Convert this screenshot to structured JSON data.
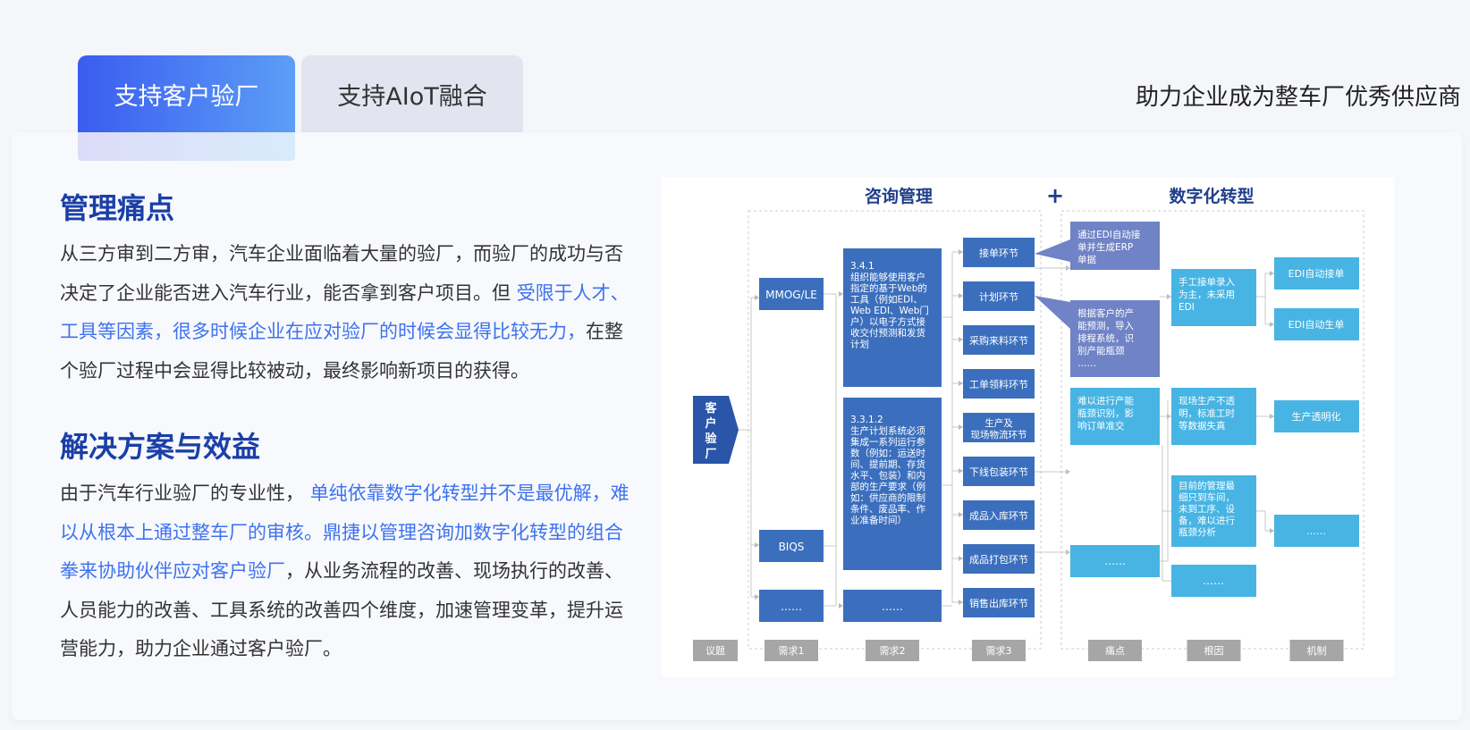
{
  "tabs": [
    {
      "label": "支持客户验厂",
      "active": true
    },
    {
      "label": "支持AIoT融合",
      "active": false
    }
  ],
  "tagline": "助力企业成为整车厂优秀供应商",
  "section1": {
    "title": "管理痛点",
    "text_a": "从三方审到二方审，汽车企业面临着大量的验厂，而验厂的成功与否决定了企业能否进入汽车行业，能否拿到客户项目。但 ",
    "highlight": "受限于人才、工具等因素，很多时候企业在应对验厂的时候会显得比较无力，",
    "text_b": "在整个验厂过程中会显得比较被动，最终影响新项目的获得。"
  },
  "section2": {
    "title": "解决方案与效益",
    "text_a": "由于汽车行业验厂的专业性， ",
    "highlight": "单纯依靠数字化转型并不是最优解，难以从根本上通过整车厂的审核。鼎捷以管理咨询加数字化转型的组合拳来协助伙伴应对客户验厂",
    "text_b": "，从业务流程的改善、现场执行的改善、人员能力的改善、工具系统的改善四个维度，加速管理变革，提升运营能力，助力企业通过客户验厂。"
  },
  "diagram": {
    "header_left": "咨询管理",
    "plus": "+",
    "header_right": "数字化转型",
    "topic": "客户验厂",
    "req1": [
      "MMOG/LE",
      "BIQS",
      "……"
    ],
    "req2": [
      [
        "3.4.1",
        "组织能够使用客户",
        "指定的基于Web的",
        "工具（例如EDI、",
        "Web EDI、Web门",
        "户）以电子方式接",
        "收交付预测和发货",
        "计划"
      ],
      [
        "3.3.1.2",
        "生产计划系统必须",
        "集成一系列运行参",
        "数（例如：运送时",
        "间、提前期、存货",
        "水平、包装）和内",
        "部的生产要求（例",
        "如：供应商的限制",
        "条件、废品率、作",
        "业准备时间）"
      ],
      [
        "……"
      ]
    ],
    "req3": [
      "接单环节",
      "计划环节",
      "采购来料环节",
      "工单领料环节",
      "生产及|现场物流环节",
      "下线包装环节",
      "成品入库环节",
      "成品打包环节",
      "销售出库环节"
    ],
    "callouts": [
      [
        "通过EDI自动接",
        "单并生成ERP",
        "单据"
      ],
      [
        "根据客户的产",
        "能预测，导入",
        "排程系统，识",
        "别产能瓶颈",
        "……"
      ]
    ],
    "pain": [
      [
        "难以进行产能",
        "瓶颈识别，影",
        "响订单准交"
      ],
      [
        "……"
      ]
    ],
    "cause": [
      [
        "手工接单录入",
        "为主，未采用",
        "EDI"
      ],
      [
        "现场生产不透",
        "明，标准工时",
        "等数据失真"
      ],
      [
        "目前的管理最",
        "细只到车间，",
        "未到工序、设",
        "备，难以进行",
        "瓶颈分析"
      ],
      [
        "……"
      ]
    ],
    "mechanism": [
      "EDI自动接单",
      "EDI自动生单",
      "生产透明化",
      "……"
    ],
    "footer": [
      "议题",
      "需求1",
      "需求2",
      "需求3",
      "痛点",
      "根因",
      "机制"
    ]
  },
  "colors": {
    "accent": "#3f72f0",
    "heading": "#1a3fa8",
    "dark_box": "#3b6fbd",
    "light_box": "#47b4e4",
    "footer_box": "#a6a6a6"
  }
}
